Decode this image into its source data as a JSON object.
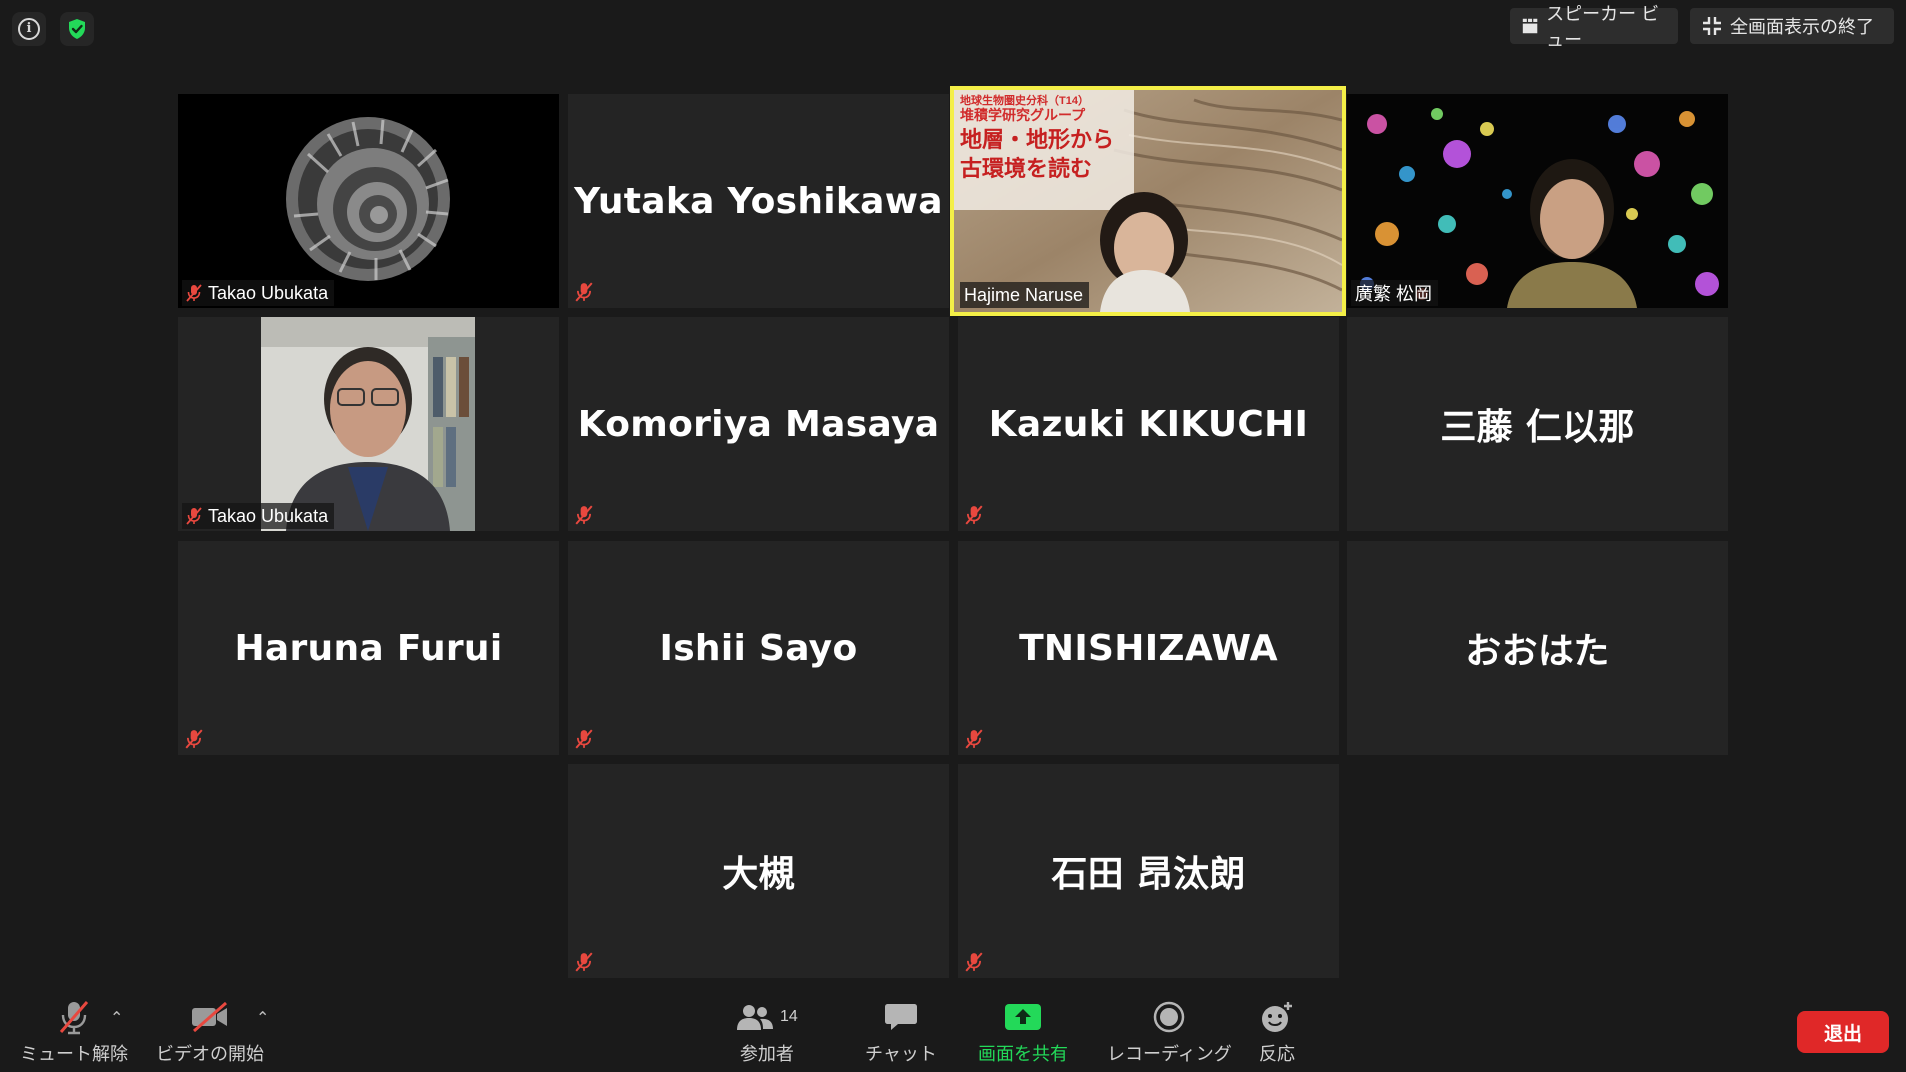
{
  "topbar": {
    "speaker_view_label": "スピーカー ビュー",
    "exit_fullscreen_label": "全画面表示の終了"
  },
  "participants": [
    {
      "name": "Takao Ubukata",
      "video": true,
      "muted": true,
      "image": "ammonite-fossil"
    },
    {
      "name": "Yutaka Yoshikawa",
      "video": false,
      "muted": true
    },
    {
      "name": "Hajime Naruse",
      "video": true,
      "muted": false,
      "active_speaker": true,
      "image": "sediment-cliff-background"
    },
    {
      "name": "廣繁 松岡",
      "video": true,
      "muted": false,
      "image": "mineral-thin-section-background"
    },
    {
      "name": "Takao Ubukata",
      "video": true,
      "muted": true,
      "image": "office-portrait"
    },
    {
      "name": "Komoriya Masaya",
      "video": false,
      "muted": true
    },
    {
      "name": "Kazuki KIKUCHI",
      "video": false,
      "muted": true
    },
    {
      "name": "三藤 仁以那",
      "video": false,
      "muted": false
    },
    {
      "name": "Haruna Furui",
      "video": false,
      "muted": true
    },
    {
      "name": "Ishii Sayo",
      "video": false,
      "muted": true
    },
    {
      "name": "TNISHIZAWA",
      "video": false,
      "muted": true
    },
    {
      "name": "おおはた",
      "video": false,
      "muted": false
    },
    {
      "name": "大槻",
      "video": false,
      "muted": true
    },
    {
      "name": "石田 昂汰朗",
      "video": false,
      "muted": true
    }
  ],
  "background_text": {
    "line1": "地球生物圏史分科（T14）",
    "line2": "堆積学研究グループ",
    "line3": "地層・地形から",
    "line4": "古環境を読む"
  },
  "toolbar": {
    "unmute_label": "ミュート解除",
    "start_video_label": "ビデオの開始",
    "participants_label": "参加者",
    "participants_count": "14",
    "chat_label": "チャット",
    "share_screen_label": "画面を共有",
    "recording_label": "レコーディング",
    "reactions_label": "反応",
    "leave_label": "退出"
  },
  "colors": {
    "active_speaker_border": "#f4ef47",
    "share_green": "#23d959",
    "leave_red": "#e02828",
    "mute_red": "#e8483f"
  }
}
